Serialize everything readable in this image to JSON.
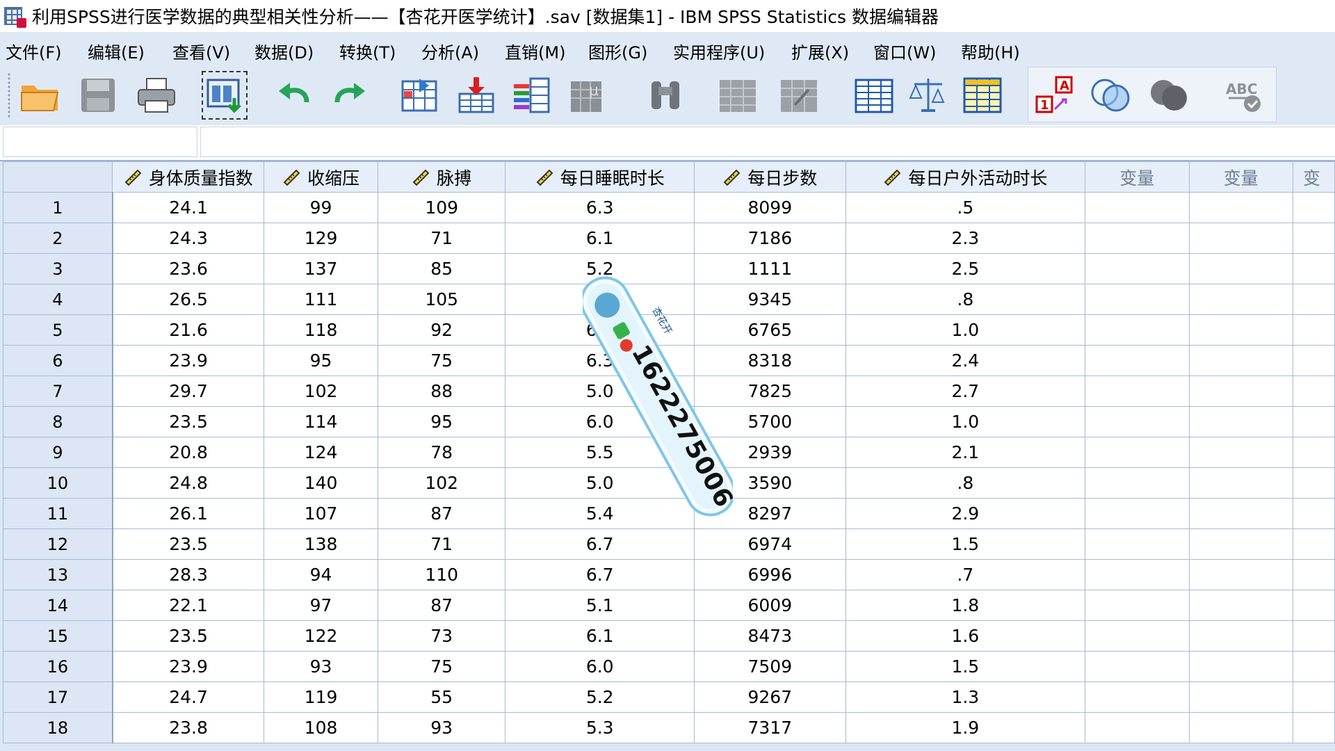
{
  "window": {
    "title": "利用SPSS进行医学数据的典型相关性分析——【杏花开医学统计】.sav [数据集1] - IBM SPSS Statistics 数据编辑器",
    "app_icon": "spss-data-editor-icon"
  },
  "menu": [
    {
      "label": "文件(F)"
    },
    {
      "label": "编辑(E)"
    },
    {
      "label": "查看(V)"
    },
    {
      "label": "数据(D)"
    },
    {
      "label": "转换(T)"
    },
    {
      "label": "分析(A)"
    },
    {
      "label": "直销(M)"
    },
    {
      "label": "图形(G)"
    },
    {
      "label": "实用程序(U)"
    },
    {
      "label": "扩展(X)"
    },
    {
      "label": "窗口(W)"
    },
    {
      "label": "帮助(H)"
    }
  ],
  "toolbar": [
    {
      "icon": "open-folder-icon"
    },
    {
      "icon": "save-icon"
    },
    {
      "icon": "print-icon"
    },
    {
      "icon": "dialog-recall-icon"
    },
    {
      "icon": "undo-icon"
    },
    {
      "icon": "redo-icon"
    },
    {
      "icon": "goto-case-icon"
    },
    {
      "icon": "goto-variable-icon"
    },
    {
      "icon": "variables-icon"
    },
    {
      "icon": "run-descriptive-icon"
    },
    {
      "icon": "find-icon"
    },
    {
      "icon": "insert-cases-icon"
    },
    {
      "icon": "insert-variable-icon"
    },
    {
      "icon": "split-file-icon"
    },
    {
      "icon": "weight-cases-icon"
    },
    {
      "icon": "select-cases-icon"
    },
    {
      "icon": "value-labels-icon"
    },
    {
      "icon": "use-sets-icon"
    },
    {
      "icon": "show-all-variables-icon"
    },
    {
      "icon": "spell-check-icon"
    }
  ],
  "editor": {
    "cell_reference": "",
    "cell_value": ""
  },
  "grid": {
    "columns": [
      "身体质量指数",
      "收缩压",
      "脉搏",
      "每日睡眠时长",
      "每日步数",
      "每日户外活动时长"
    ],
    "empty_columns": [
      "变量",
      "变量",
      "变"
    ],
    "rows": [
      {
        "n": "1",
        "cells": [
          "24.1",
          "99",
          "109",
          "6.3",
          "8099",
          ".5"
        ]
      },
      {
        "n": "2",
        "cells": [
          "24.3",
          "129",
          "71",
          "6.1",
          "7186",
          "2.3"
        ]
      },
      {
        "n": "3",
        "cells": [
          "23.6",
          "137",
          "85",
          "5.2",
          "1111",
          "2.5"
        ]
      },
      {
        "n": "4",
        "cells": [
          "26.5",
          "111",
          "105",
          "6.",
          "9345",
          ".8"
        ]
      },
      {
        "n": "5",
        "cells": [
          "21.6",
          "118",
          "92",
          "6.7",
          "6765",
          "1.0"
        ]
      },
      {
        "n": "6",
        "cells": [
          "23.9",
          "95",
          "75",
          "6.3",
          "8318",
          "2.4"
        ]
      },
      {
        "n": "7",
        "cells": [
          "29.7",
          "102",
          "88",
          "5.0",
          "7825",
          "2.7"
        ]
      },
      {
        "n": "8",
        "cells": [
          "23.5",
          "114",
          "95",
          "6.0",
          "5700",
          "1.0"
        ]
      },
      {
        "n": "9",
        "cells": [
          "20.8",
          "124",
          "78",
          "5.5",
          "2939",
          "2.1"
        ]
      },
      {
        "n": "10",
        "cells": [
          "24.8",
          "140",
          "102",
          "5.0",
          "3590",
          ".8"
        ]
      },
      {
        "n": "11",
        "cells": [
          "26.1",
          "107",
          "87",
          "5.4",
          "8297",
          "2.9"
        ]
      },
      {
        "n": "12",
        "cells": [
          "23.5",
          "138",
          "71",
          "6.7",
          "6974",
          "1.5"
        ]
      },
      {
        "n": "13",
        "cells": [
          "28.3",
          "94",
          "110",
          "6.7",
          "6996",
          ".7"
        ]
      },
      {
        "n": "14",
        "cells": [
          "22.1",
          "97",
          "87",
          "5.1",
          "6009",
          "1.8"
        ]
      },
      {
        "n": "15",
        "cells": [
          "23.5",
          "122",
          "73",
          "6.1",
          "8473",
          "1.6"
        ]
      },
      {
        "n": "16",
        "cells": [
          "23.9",
          "93",
          "75",
          "6.0",
          "7509",
          "1.5"
        ]
      },
      {
        "n": "17",
        "cells": [
          "24.7",
          "119",
          "55",
          "5.2",
          "9267",
          "1.3"
        ]
      },
      {
        "n": "18",
        "cells": [
          "23.8",
          "108",
          "93",
          "5.3",
          "7317",
          "1.9"
        ]
      }
    ]
  },
  "watermark": {
    "text": "1622275006",
    "brand": "杏花开"
  },
  "colors": {
    "menubar_bg": "#dfe9f6",
    "header_bg": "#e6eef9",
    "row_header_bg": "#dce6f4",
    "grid_line": "#a7bad3"
  }
}
